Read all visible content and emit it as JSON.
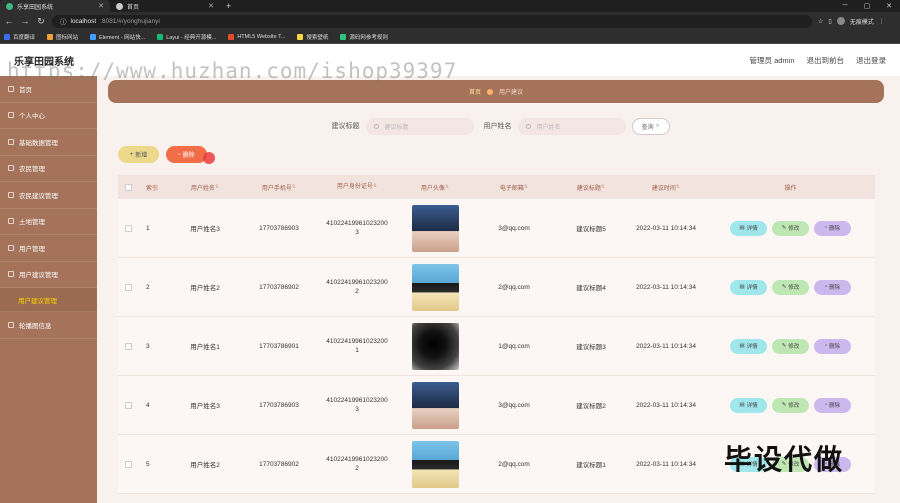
{
  "browser": {
    "tabs": [
      {
        "label": "乐享田园系统",
        "active": true
      },
      {
        "label": "首页",
        "active": false
      }
    ],
    "url_prefix": "localhost",
    "url_rest": ":8081/#/yonghujianyi",
    "profile_label": "无痕模式",
    "bookmarks": [
      {
        "label": "百度翻译",
        "color": "#3b6df0"
      },
      {
        "label": "图标网站",
        "color": "#f0a03b"
      },
      {
        "label": "Element - 网站快...",
        "color": "#409eff"
      },
      {
        "label": "Layui - 经典开源模...",
        "color": "#16b777"
      },
      {
        "label": "HTML5 Website T...",
        "color": "#e34c26"
      },
      {
        "label": "搜索壁纸",
        "color": "#f5d742"
      },
      {
        "label": "源码网参考规则",
        "color": "#2ec27e"
      }
    ]
  },
  "header": {
    "title": "乐享田园系统",
    "user_label": "管理员 admin",
    "back_label": "退出到前台",
    "logout_label": "退出登录"
  },
  "sidebar": {
    "items": [
      {
        "label": "首页",
        "sub": false
      },
      {
        "label": "个人中心",
        "sub": false
      },
      {
        "label": "基础数据管理",
        "sub": false
      },
      {
        "label": "农民管理",
        "sub": false
      },
      {
        "label": "农民建议管理",
        "sub": false
      },
      {
        "label": "土地管理",
        "sub": false
      },
      {
        "label": "用户管理",
        "sub": false
      },
      {
        "label": "用户建议管理",
        "sub": false
      },
      {
        "label": "用户建议管理",
        "sub": true
      },
      {
        "label": "轮播图信息",
        "sub": false
      }
    ]
  },
  "breadcrumb": {
    "home": "首页",
    "current": "用户建议"
  },
  "search": {
    "title_label": "建议标题",
    "title_placeholder": "建议标题",
    "name_label": "用户姓名",
    "name_placeholder": "用户姓名",
    "button_label": "查询"
  },
  "toolbar": {
    "add_label": "新增",
    "delete_label": "删除"
  },
  "table": {
    "headers": [
      "索引",
      "用户姓名",
      "用户手机号",
      "用户身份证号",
      "用户头像",
      "电子邮箱",
      "建议标题",
      "建议时间",
      "操作"
    ],
    "rows": [
      {
        "idx": "1",
        "name": "用户姓名3",
        "phone": "17703786903",
        "idno_1": "41022419961023200",
        "idno_2": "3",
        "email": "3@qq.com",
        "title": "建议标题5",
        "time": "2022-03-11 10:14:34",
        "pic": "a"
      },
      {
        "idx": "2",
        "name": "用户姓名2",
        "phone": "17703786902",
        "idno_1": "41022419961023200",
        "idno_2": "2",
        "email": "2@qq.com",
        "title": "建议标题4",
        "time": "2022-03-11 10:14:34",
        "pic": "b"
      },
      {
        "idx": "3",
        "name": "用户姓名1",
        "phone": "17703786901",
        "idno_1": "41022419961023200",
        "idno_2": "1",
        "email": "1@qq.com",
        "title": "建议标题3",
        "time": "2022-03-11 10:14:34",
        "pic": "c"
      },
      {
        "idx": "4",
        "name": "用户姓名3",
        "phone": "17703786903",
        "idno_1": "41022419961023200",
        "idno_2": "3",
        "email": "3@qq.com",
        "title": "建议标题2",
        "time": "2022-03-11 10:14:34",
        "pic": "a"
      },
      {
        "idx": "5",
        "name": "用户姓名2",
        "phone": "17703786902",
        "idno_1": "41022419961023200",
        "idno_2": "2",
        "email": "2@qq.com",
        "title": "建议标题1",
        "time": "2022-03-11 10:14:34",
        "pic": "b"
      }
    ],
    "ops": {
      "detail": "详情",
      "edit": "修改",
      "remove": "删除"
    }
  },
  "overlays": {
    "watermark": "https://www.huzhan.com/ishop39397",
    "corner_text": "毕设代做"
  },
  "colors": {
    "sidebar": "#a5735a",
    "accent_yellow": "#ffd400",
    "delete_btn": "#f06d48",
    "detail_btn": "#9fe7ea",
    "edit_btn": "#bfe7b4",
    "remove_btn": "#cdb8ee"
  }
}
